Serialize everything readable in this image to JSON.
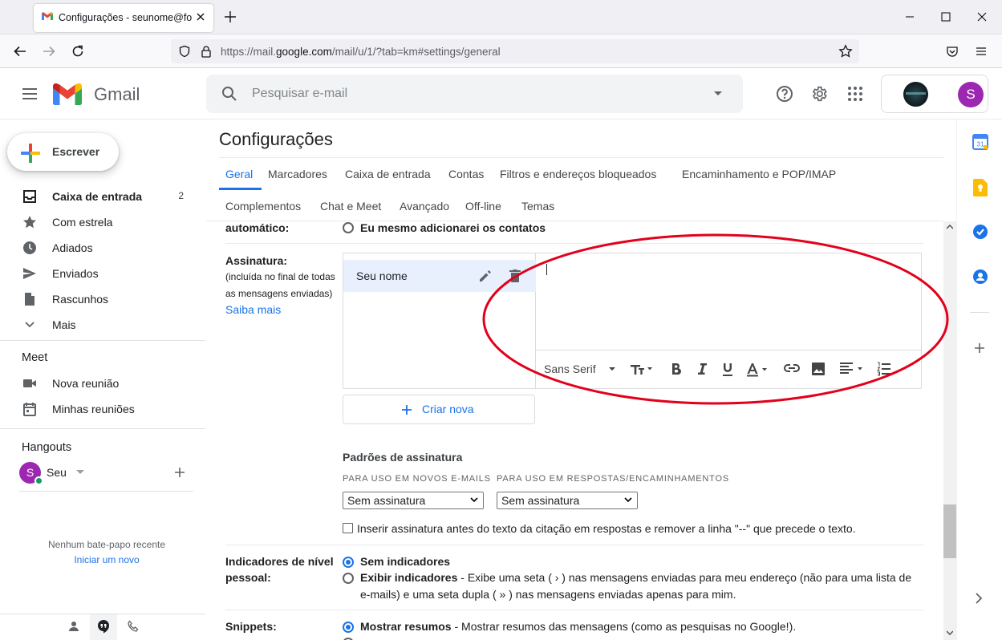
{
  "browser": {
    "tab_title": "Configurações - seunome@fon",
    "new_tab": "+",
    "url_prefix": "https://mail.",
    "url_domain": "google.com",
    "url_rest": "/mail/u/1/?tab=km#settings/general"
  },
  "gmail": {
    "logo_text": "Gmail",
    "search_placeholder": "Pesquisar e-mail",
    "avatar_letter": "S"
  },
  "nav": {
    "compose": "Escrever",
    "items": [
      {
        "label": "Caixa de entrada",
        "count": "2"
      },
      {
        "label": "Com estrela"
      },
      {
        "label": "Adiados"
      },
      {
        "label": "Enviados"
      },
      {
        "label": "Rascunhos"
      },
      {
        "label": "Mais"
      }
    ],
    "meet_title": "Meet",
    "meet_items": [
      "Nova reunião",
      "Minhas reuniões"
    ],
    "hangouts_title": "Hangouts",
    "hangouts_user": "Seu",
    "no_chats": "Nenhum bate-papo recente",
    "start_new": "Iniciar um novo"
  },
  "settings": {
    "title": "Configurações",
    "tabs_row1": [
      "Geral",
      "Marcadores",
      "Caixa de entrada",
      "Contas",
      "Filtros e endereços bloqueados",
      "Encaminhamento e POP/IMAP"
    ],
    "tabs_row2": [
      "Complementos",
      "Chat e Meet",
      "Avançado",
      "Off-line",
      "Temas"
    ],
    "auto_label": "automático:",
    "auto_option": "Eu mesmo adicionarei os contatos",
    "signature_label": "Assinatura:",
    "signature_sub1": "(incluída no final de todas",
    "signature_sub2": "as mensagens enviadas)",
    "learn_more": "Saiba mais",
    "signature_name": "Seu nome",
    "font_name": "Sans Serif",
    "create_new": "Criar nova",
    "defaults_title": "Padrões de assinatura",
    "new_emails_label": "PARA USO EM NOVOS E-MAILS",
    "replies_label": "PARA USO EM RESPOSTAS/ENCAMINHAMENTOS",
    "select_new": "Sem assinatura",
    "select_reply": "Sem assinatura",
    "insert_before": "Inserir assinatura antes do texto da citação em respostas e remover a linha \"--\" que precede o texto.",
    "indicators_label1": "Indicadores de nível",
    "indicators_label2": "pessoal:",
    "no_indicators": "Sem indicadores",
    "show_indicators": "Exibir indicadores",
    "show_indicators_desc1": " - Exibe uma seta ( › ) nas mensagens enviadas para meu endereço (não para uma lista de",
    "show_indicators_desc2": "e-mails) e uma seta dupla ( » ) nas mensagens enviadas apenas para mim.",
    "snippets_label": "Snippets:",
    "show_snippets": "Mostrar resumos",
    "show_snippets_desc": " - Mostrar resumos das mensagens (como as pesquisas no Google!)."
  },
  "colors": {
    "accent": "#1a73e8",
    "annotation": "#e3001b",
    "selected_sig": "#e8f0fe"
  }
}
